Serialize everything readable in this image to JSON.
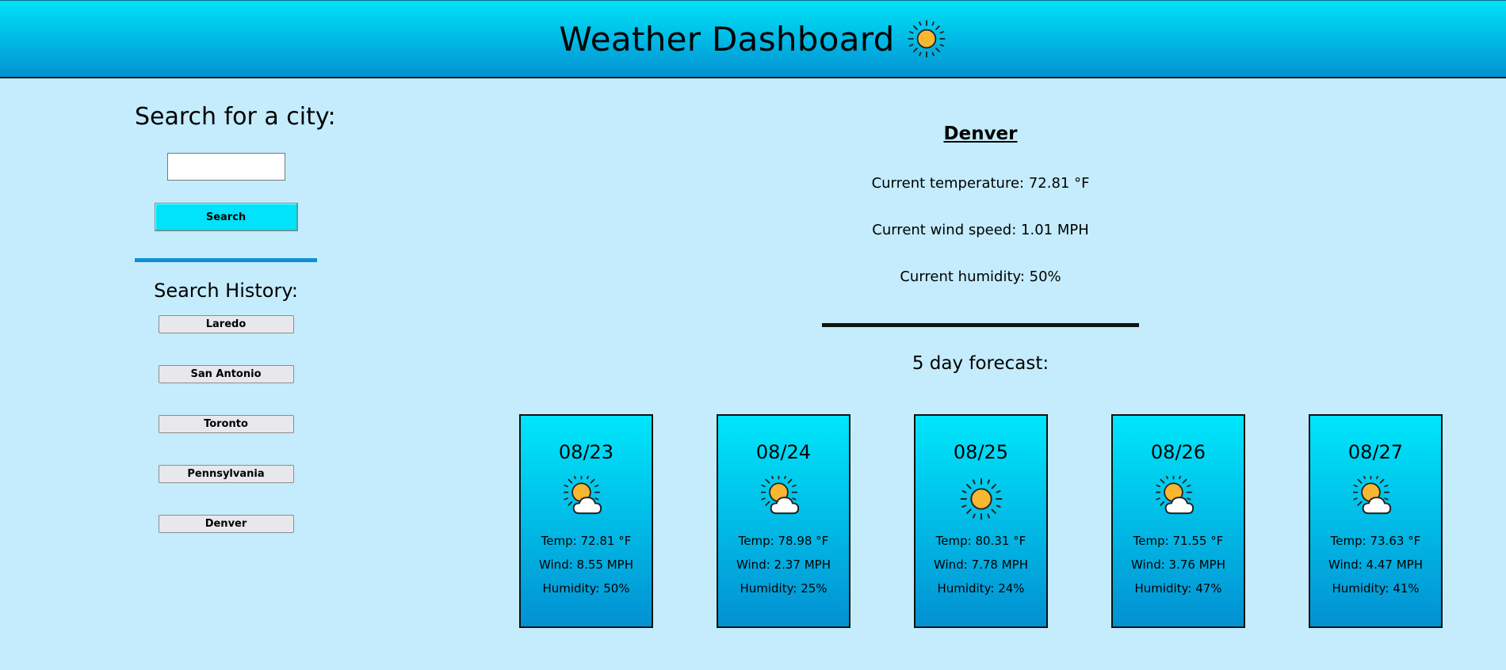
{
  "header": {
    "title": "Weather Dashboard",
    "icon": "sun-icon"
  },
  "sidebar": {
    "search_title": "Search for a city:",
    "search_input_value": "",
    "search_input_placeholder": "",
    "search_button": "Search",
    "history_title": "Search History:",
    "history": [
      "Laredo",
      "San Antonio",
      "Toronto",
      "Pennsylvania",
      "Denver"
    ]
  },
  "current": {
    "city": "Denver",
    "temperature": "Current temperature: 72.81 °F",
    "wind": "Current wind speed: 1.01 MPH",
    "humidity": "Current humidity: 50%"
  },
  "forecast": {
    "title": "5 day forecast:",
    "days": [
      {
        "date": "08/23",
        "icon": "partly-cloudy-icon",
        "temp": "Temp: 72.81 °F",
        "wind": "Wind: 8.55 MPH",
        "humidity": "Humidity: 50%"
      },
      {
        "date": "08/24",
        "icon": "partly-cloudy-icon",
        "temp": "Temp: 78.98 °F",
        "wind": "Wind: 2.37 MPH",
        "humidity": "Humidity: 25%"
      },
      {
        "date": "08/25",
        "icon": "sun-icon",
        "temp": "Temp: 80.31 °F",
        "wind": "Wind: 7.78 MPH",
        "humidity": "Humidity: 24%"
      },
      {
        "date": "08/26",
        "icon": "partly-cloudy-icon",
        "temp": "Temp: 71.55 °F",
        "wind": "Wind: 3.76 MPH",
        "humidity": "Humidity: 47%"
      },
      {
        "date": "08/27",
        "icon": "partly-cloudy-icon",
        "temp": "Temp: 73.63 °F",
        "wind": "Wind: 4.47 MPH",
        "humidity": "Humidity: 41%"
      }
    ]
  },
  "colors": {
    "background": "#c4ecfc",
    "header_gradient_top": "#00e2f8",
    "header_gradient_bottom": "#0292d2",
    "button": "#00e3fa",
    "sidebar_divider": "#0d8ed6",
    "sun": "#f7b731"
  }
}
